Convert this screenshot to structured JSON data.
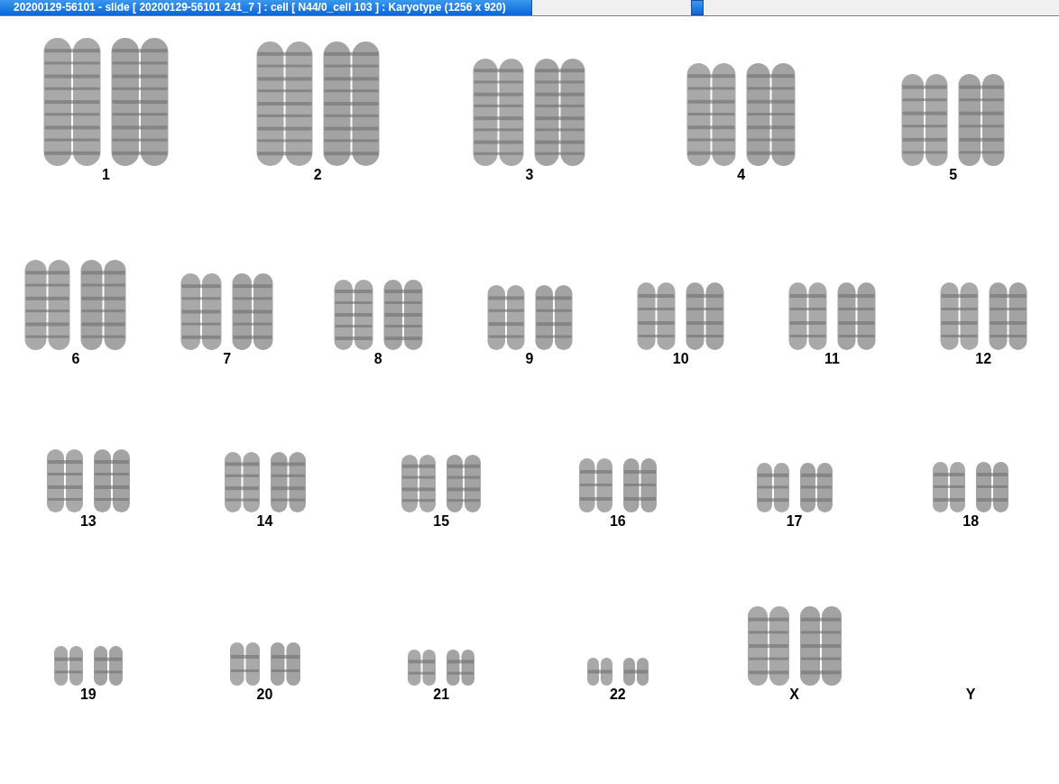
{
  "title_bar": {
    "title": "20200129-56101 - slide [ 20200129-56101 241_7 ] : cell [ N44/0_cell 103 ] : Karyotype  (1256 x 920)"
  },
  "karyotype": {
    "rows": [
      [
        {
          "label": "1",
          "shown": true
        },
        {
          "label": "2",
          "shown": true
        },
        {
          "label": "3",
          "shown": true
        },
        {
          "label": "4",
          "shown": true
        },
        {
          "label": "5",
          "shown": true
        }
      ],
      [
        {
          "label": "6",
          "shown": true
        },
        {
          "label": "7",
          "shown": true
        },
        {
          "label": "8",
          "shown": true
        },
        {
          "label": "9",
          "shown": true
        },
        {
          "label": "10",
          "shown": true
        },
        {
          "label": "11",
          "shown": true
        },
        {
          "label": "12",
          "shown": true
        }
      ],
      [
        {
          "label": "13",
          "shown": true
        },
        {
          "label": "14",
          "shown": true
        },
        {
          "label": "15",
          "shown": true
        },
        {
          "label": "16",
          "shown": true
        },
        {
          "label": "17",
          "shown": true
        },
        {
          "label": "18",
          "shown": true
        }
      ],
      [
        {
          "label": "19",
          "shown": true
        },
        {
          "label": "20",
          "shown": true
        },
        {
          "label": "21",
          "shown": true
        },
        {
          "label": "22",
          "shown": true
        },
        {
          "label": "X",
          "shown": true
        },
        {
          "label": "Y",
          "shown": false
        }
      ]
    ]
  }
}
